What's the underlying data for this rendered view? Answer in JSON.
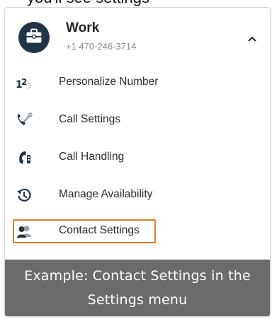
{
  "account": {
    "name": "Work",
    "number": "+1 470-246-3714",
    "avatar_icon": "briefcase-icon",
    "collapse_icon": "chevron-up-icon"
  },
  "menu": {
    "items": [
      {
        "label": "Personalize Number",
        "icon": "number-123-icon"
      },
      {
        "label": "Call Settings",
        "icon": "phone-wrench-icon"
      },
      {
        "label": "Call Handling",
        "icon": "phone-handling-icon"
      },
      {
        "label": "Manage Availability",
        "icon": "history-clock-icon"
      },
      {
        "label": "Contact Settings",
        "icon": "contacts-people-icon"
      }
    ]
  },
  "caption": {
    "text": "Example: Contact Settings in the Settings menu"
  },
  "colors": {
    "avatar_bg": "#1f3447",
    "highlight_border": "#f2741f",
    "caption_bg": "#6a6b6c"
  }
}
